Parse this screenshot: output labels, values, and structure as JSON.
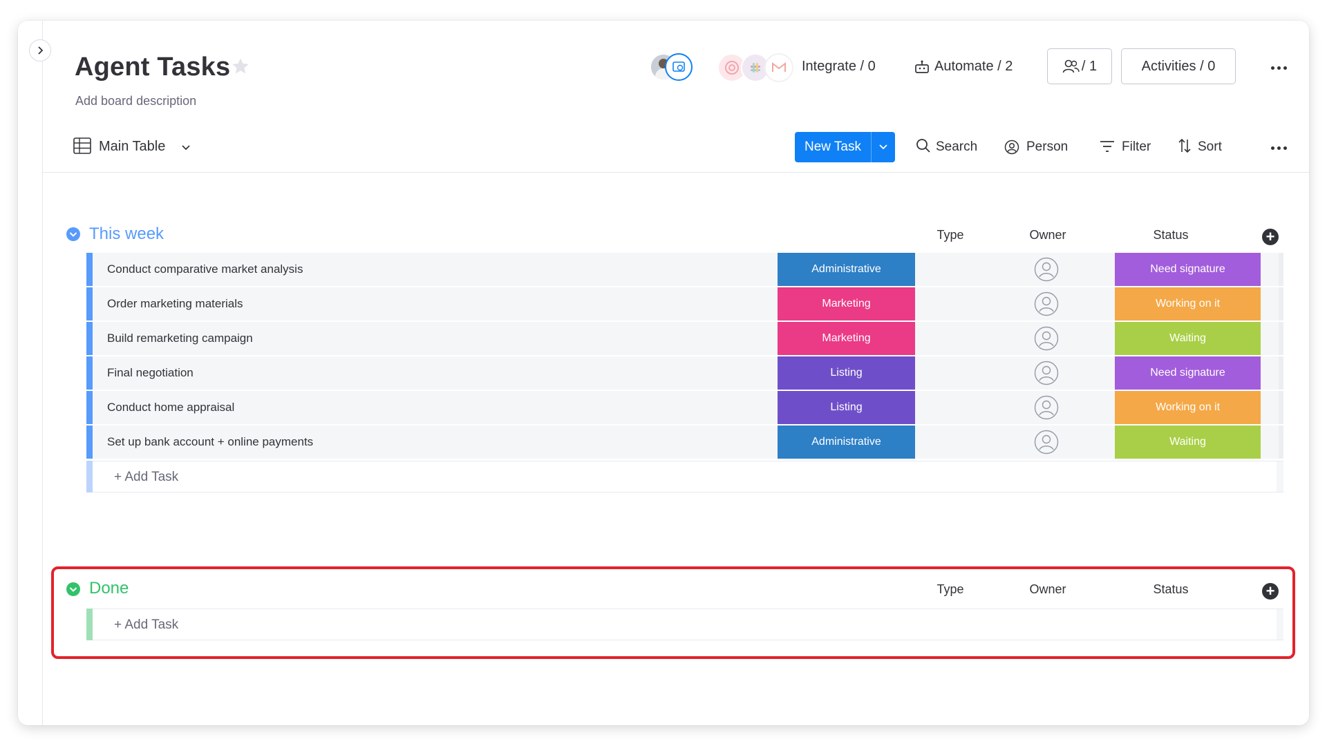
{
  "board": {
    "title": "Agent Tasks",
    "description": "Add board description"
  },
  "header": {
    "integrate_label": "Integrate / 0",
    "automate_label": "Automate / 2",
    "members_count": "/ 1",
    "activities_label": "Activities / 0"
  },
  "toolbar": {
    "view_label": "Main Table",
    "new_task_label": "New Task",
    "search_label": "Search",
    "person_label": "Person",
    "filter_label": "Filter",
    "sort_label": "Sort"
  },
  "columns": {
    "type": "Type",
    "owner": "Owner",
    "status": "Status"
  },
  "groups": [
    {
      "title": "This week",
      "color": "#579bfc",
      "add_label": "+ Add Task",
      "rows": [
        {
          "name": "Conduct comparative market analysis",
          "type": "Administrative",
          "status": "Need signature"
        },
        {
          "name": "Order marketing materials",
          "type": "Marketing",
          "status": "Working on it"
        },
        {
          "name": "Build remarketing campaign",
          "type": "Marketing",
          "status": "Waiting"
        },
        {
          "name": "Final negotiation",
          "type": "Listing",
          "status": "Need signature"
        },
        {
          "name": "Conduct home appraisal",
          "type": "Listing",
          "status": "Working on it"
        },
        {
          "name": "Set up bank account + online payments",
          "type": "Administrative",
          "status": "Waiting"
        }
      ]
    },
    {
      "title": "Done",
      "color": "#33c26a",
      "add_label": "+ Add Task",
      "rows": []
    }
  ],
  "colors": {
    "type": {
      "Administrative": "#2d7fc6",
      "Marketing": "#eb3a86",
      "Listing": "#6f4fc9"
    },
    "status": {
      "Need signature": "#a25ddc",
      "Working on it": "#f4a847",
      "Waiting": "#a9cf48"
    },
    "highlight": "#e2222b",
    "primary": "#0f80f5"
  }
}
